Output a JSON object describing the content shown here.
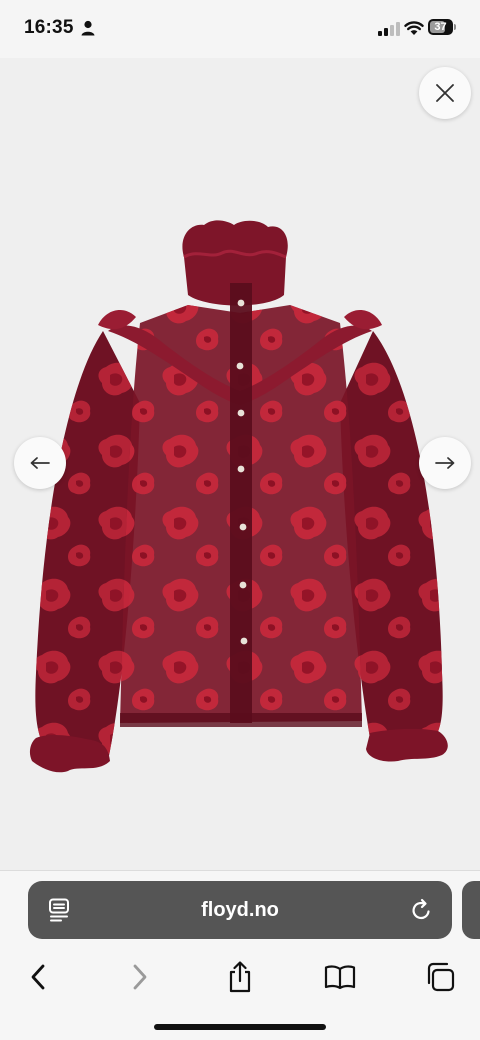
{
  "status_bar": {
    "time": "16:35",
    "battery": "37",
    "icons": [
      "person-icon",
      "cellular-signal-icon",
      "wifi-icon",
      "battery-icon"
    ]
  },
  "viewer": {
    "image_name": "burgundy-floral-ruffle-blouse",
    "colors": {
      "fabric": "#7a1527",
      "fabric_dark": "#5a0d1a",
      "metallic": "#c9283c"
    },
    "buttons": [
      "close-icon",
      "arrow-left-icon",
      "arrow-right-icon"
    ]
  },
  "browser": {
    "url": "floyd.no",
    "toolbar_icons": [
      "back-icon",
      "forward-icon",
      "share-icon",
      "bookmarks-icon",
      "tabs-icon"
    ]
  }
}
